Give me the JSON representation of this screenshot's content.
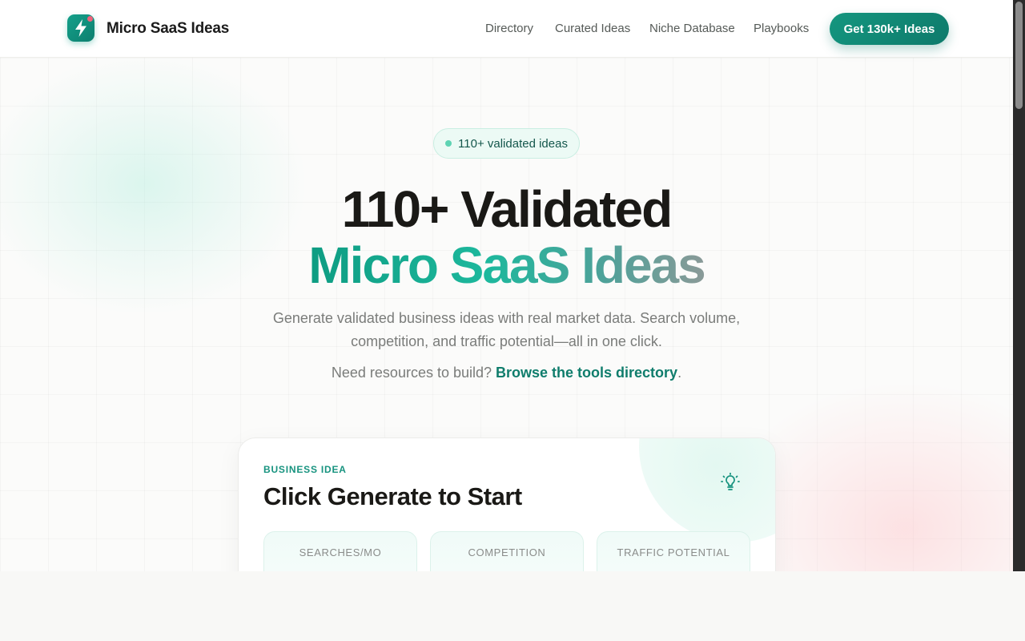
{
  "header": {
    "brand": "Micro SaaS Ideas",
    "nav": [
      "Directory",
      "Curated Ideas",
      "Niche Database",
      "Playbooks"
    ],
    "cta": "Get 130k+ Ideas"
  },
  "hero": {
    "badge": "110+ validated ideas",
    "title_line1": "110+ Validated",
    "title_line2": "Micro SaaS Ideas",
    "subtitle": "Generate validated business ideas with real market data. Search volume, competition, and traffic potential—all in one click.",
    "resources_prefix": "Need resources to build? ",
    "resources_link": "Browse the tools directory",
    "resources_suffix": "."
  },
  "card": {
    "label": "BUSINESS IDEA",
    "title": "Click Generate to Start",
    "stats": [
      "SEARCHES/MO",
      "COMPETITION",
      "TRAFFIC POTENTIAL"
    ]
  },
  "colors": {
    "accent": "#0e7a6b",
    "accent_light": "#14a08a",
    "badge_bg": "#ecfaf5",
    "logo_dot": "#f0627c"
  },
  "icons": {
    "logo": "lightning-bolt-icon",
    "card": "lightbulb-icon"
  }
}
